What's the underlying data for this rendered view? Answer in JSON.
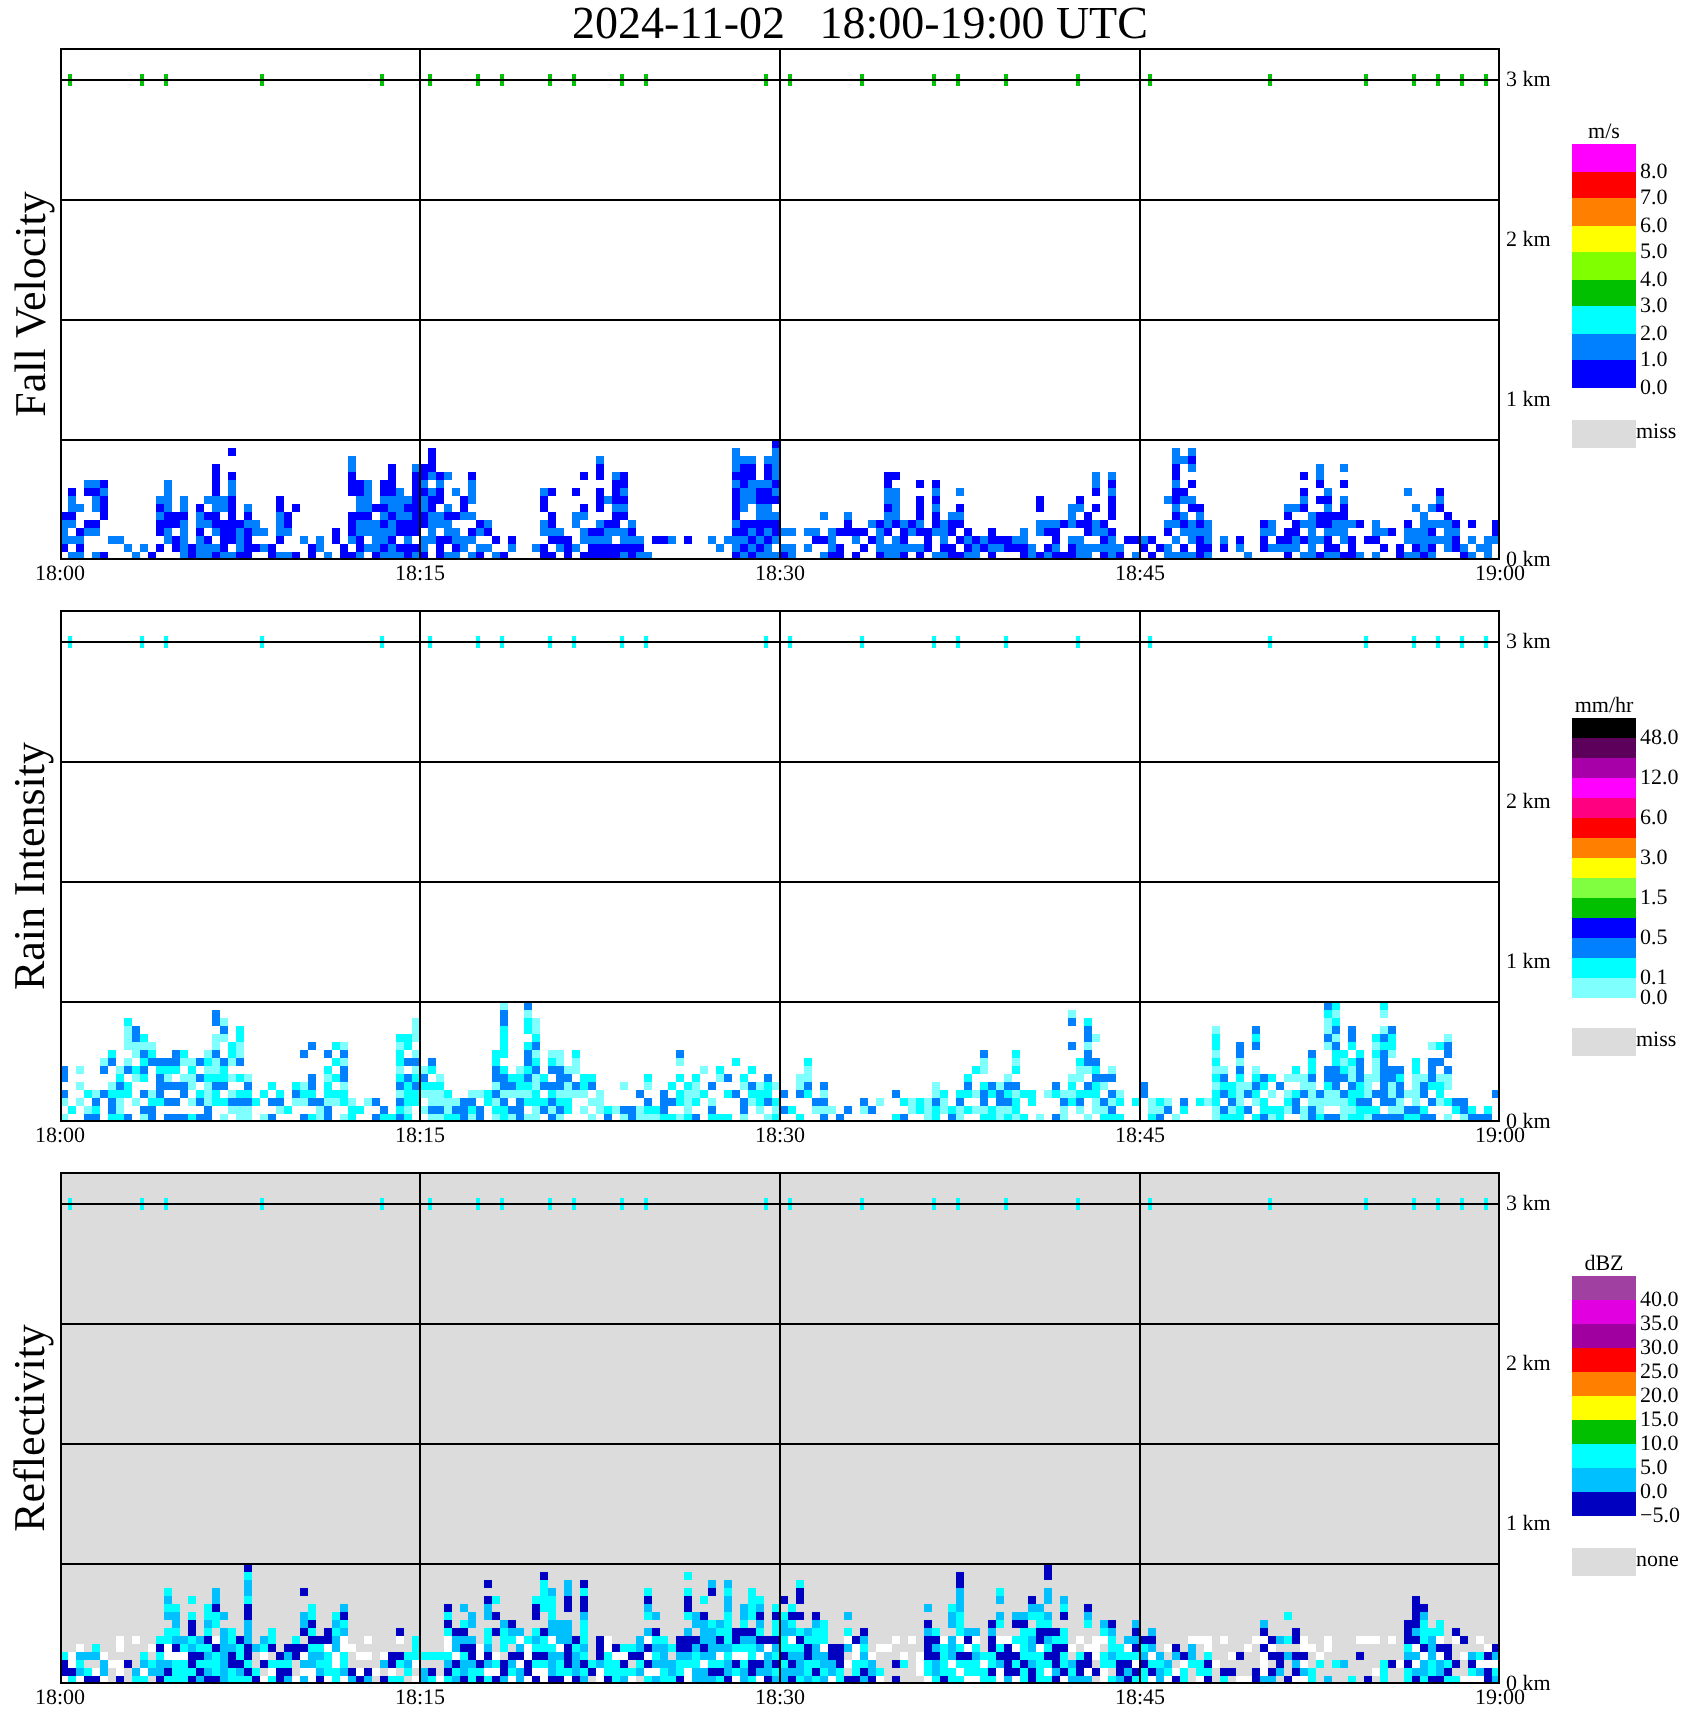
{
  "title": "2024-11-02   18:00-19:00 UTC",
  "panels": [
    {
      "kind": "velocity",
      "ylabel": "Fall Velocity",
      "shaded": false,
      "heights": [
        "3 km",
        "2 km",
        "1 km",
        "0 km"
      ],
      "times": [
        "18:00",
        "18:15",
        "18:30",
        "18:45",
        "19:00"
      ],
      "legend": {
        "unit": "m/s",
        "swatches": [
          {
            "color": "#ff00ff",
            "label": "8.0"
          },
          {
            "color": "#ff0000",
            "label": "7.0"
          },
          {
            "color": "#ff8000",
            "label": "6.0"
          },
          {
            "color": "#ffff00",
            "label": "5.0"
          },
          {
            "color": "#80ff00",
            "label": "4.0"
          },
          {
            "color": "#00c000",
            "label": "3.0"
          },
          {
            "color": "#00ffff",
            "label": "2.0"
          },
          {
            "color": "#0080ff",
            "label": "1.0"
          },
          {
            "color": "#0000ff",
            "label": "0.0"
          }
        ],
        "missing": {
          "label": "miss",
          "color": "#dcdcdc"
        }
      }
    },
    {
      "kind": "rain",
      "ylabel": "Rain Intensity",
      "shaded": false,
      "heights": [
        "3 km",
        "2 km",
        "1 km",
        "0 km"
      ],
      "times": [
        "18:00",
        "18:15",
        "18:30",
        "18:45",
        "19:00"
      ],
      "legend": {
        "unit": "mm/hr",
        "swatches": [
          {
            "color": "#000000",
            "label": "48.0"
          },
          {
            "color": "#5c005c"
          },
          {
            "color": "#a800a8",
            "label": "12.0"
          },
          {
            "color": "#ff00ff"
          },
          {
            "color": "#ff0080",
            "label": "6.0"
          },
          {
            "color": "#ff0000"
          },
          {
            "color": "#ff8000",
            "label": "3.0"
          },
          {
            "color": "#ffff00"
          },
          {
            "color": "#80ff40",
            "label": "1.5"
          },
          {
            "color": "#00c000"
          },
          {
            "color": "#0000ff",
            "label": "0.5"
          },
          {
            "color": "#0080ff"
          },
          {
            "color": "#00ffff",
            "label": "0.1"
          },
          {
            "color": "#80ffff",
            "label": "0.0"
          }
        ],
        "missing": {
          "label": "miss",
          "color": "#dcdcdc"
        }
      }
    },
    {
      "kind": "reflectivity",
      "ylabel": "Reflectivity",
      "shaded": true,
      "heights": [
        "3 km",
        "2 km",
        "1 km",
        "0 km"
      ],
      "times": [
        "18:00",
        "18:15",
        "18:30",
        "18:45",
        "19:00"
      ],
      "legend": {
        "unit": "dBZ",
        "swatches": [
          {
            "color": "#a040a0",
            "label": "40.0"
          },
          {
            "color": "#e000e0",
            "label": "35.0"
          },
          {
            "color": "#a000a0",
            "label": "30.0"
          },
          {
            "color": "#ff0000",
            "label": "25.0"
          },
          {
            "color": "#ff8000",
            "label": "20.0"
          },
          {
            "color": "#ffff00",
            "label": "15.0"
          },
          {
            "color": "#00c000",
            "label": "10.0"
          },
          {
            "color": "#00ffff",
            "label": "5.0"
          },
          {
            "color": "#00c0ff",
            "label": "0.0"
          },
          {
            "color": "#0000c0",
            "label": "−5.0"
          }
        ],
        "missing": {
          "label": "none",
          "color": "#dcdcdc"
        }
      }
    }
  ]
}
